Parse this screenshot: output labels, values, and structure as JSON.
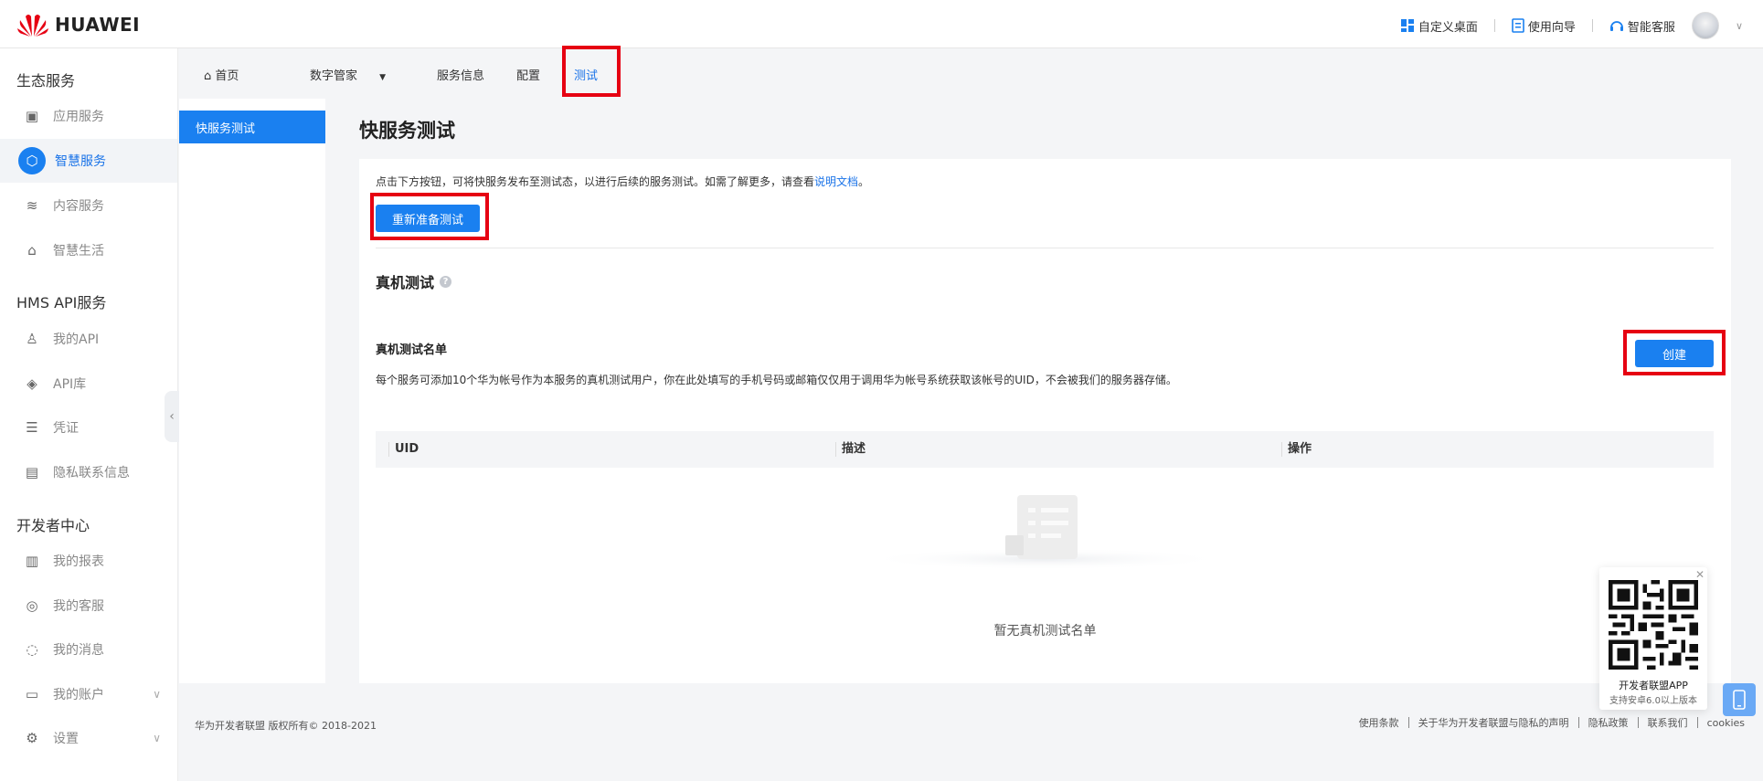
{
  "header": {
    "brand": "HUAWEI",
    "links": [
      {
        "label": "自定义桌面",
        "icon": "dashboard-icon"
      },
      {
        "label": "使用向导",
        "icon": "guide-icon"
      },
      {
        "label": "智能客服",
        "icon": "headset-icon"
      }
    ]
  },
  "sidebar": {
    "groups": [
      "生态服务",
      "HMS API服务",
      "开发者中心"
    ],
    "items": [
      {
        "label": "应用服务",
        "icon": "app-service-icon"
      },
      {
        "label": "智慧服务",
        "icon": "smart-service-icon",
        "active": true
      },
      {
        "label": "内容服务",
        "icon": "layers-icon"
      },
      {
        "label": "智慧生活",
        "icon": "home-icon"
      },
      {
        "label": "我的API",
        "icon": "user-api-icon"
      },
      {
        "label": "API库",
        "icon": "cube-icon"
      },
      {
        "label": "凭证",
        "icon": "credential-icon"
      },
      {
        "label": "隐私联系信息",
        "icon": "privacy-icon"
      },
      {
        "label": "我的报表",
        "icon": "chart-icon"
      },
      {
        "label": "我的客服",
        "icon": "support-icon"
      },
      {
        "label": "我的消息",
        "icon": "message-icon"
      },
      {
        "label": "我的账户",
        "icon": "wallet-icon"
      },
      {
        "label": "设置",
        "icon": "gear-icon"
      }
    ]
  },
  "subnav": {
    "home": "首页",
    "digital_steward": "数字管家",
    "service_info": "服务信息",
    "config": "配置",
    "test": "测试"
  },
  "menu2": {
    "item": "快服务测试"
  },
  "main": {
    "title": "快服务测试",
    "desc_prefix": "点击下方按钮，可将快服务发布至测试态，以进行后续的服务测试。如需了解更多，请查看",
    "desc_link": "说明文档",
    "desc_suffix": "。",
    "reprepare_button": "重新准备测试",
    "section_title": "真机测试",
    "list_title": "真机测试名单",
    "list_desc": "每个服务可添加10个华为帐号作为本服务的真机测试用户，你在此处填写的手机号码或邮箱仅仅用于调用华为帐号系统获取该帐号的UID，不会被我们的服务器存储。",
    "create_button": "创建",
    "table_headers": [
      "UID",
      "描述",
      "操作"
    ],
    "empty_text": "暂无真机测试名单"
  },
  "qr": {
    "title": "开发者联盟APP",
    "subtitle": "支持安卓6.0以上版本"
  },
  "footer": {
    "copyright": "华为开发者联盟 版权所有© 2018-2021",
    "links": [
      "使用条款",
      "关于华为开发者联盟与隐私的声明",
      "隐私政策",
      "联系我们",
      "cookies"
    ]
  },
  "colors": {
    "accent": "#1a80f0",
    "highlight": "#e60012"
  }
}
